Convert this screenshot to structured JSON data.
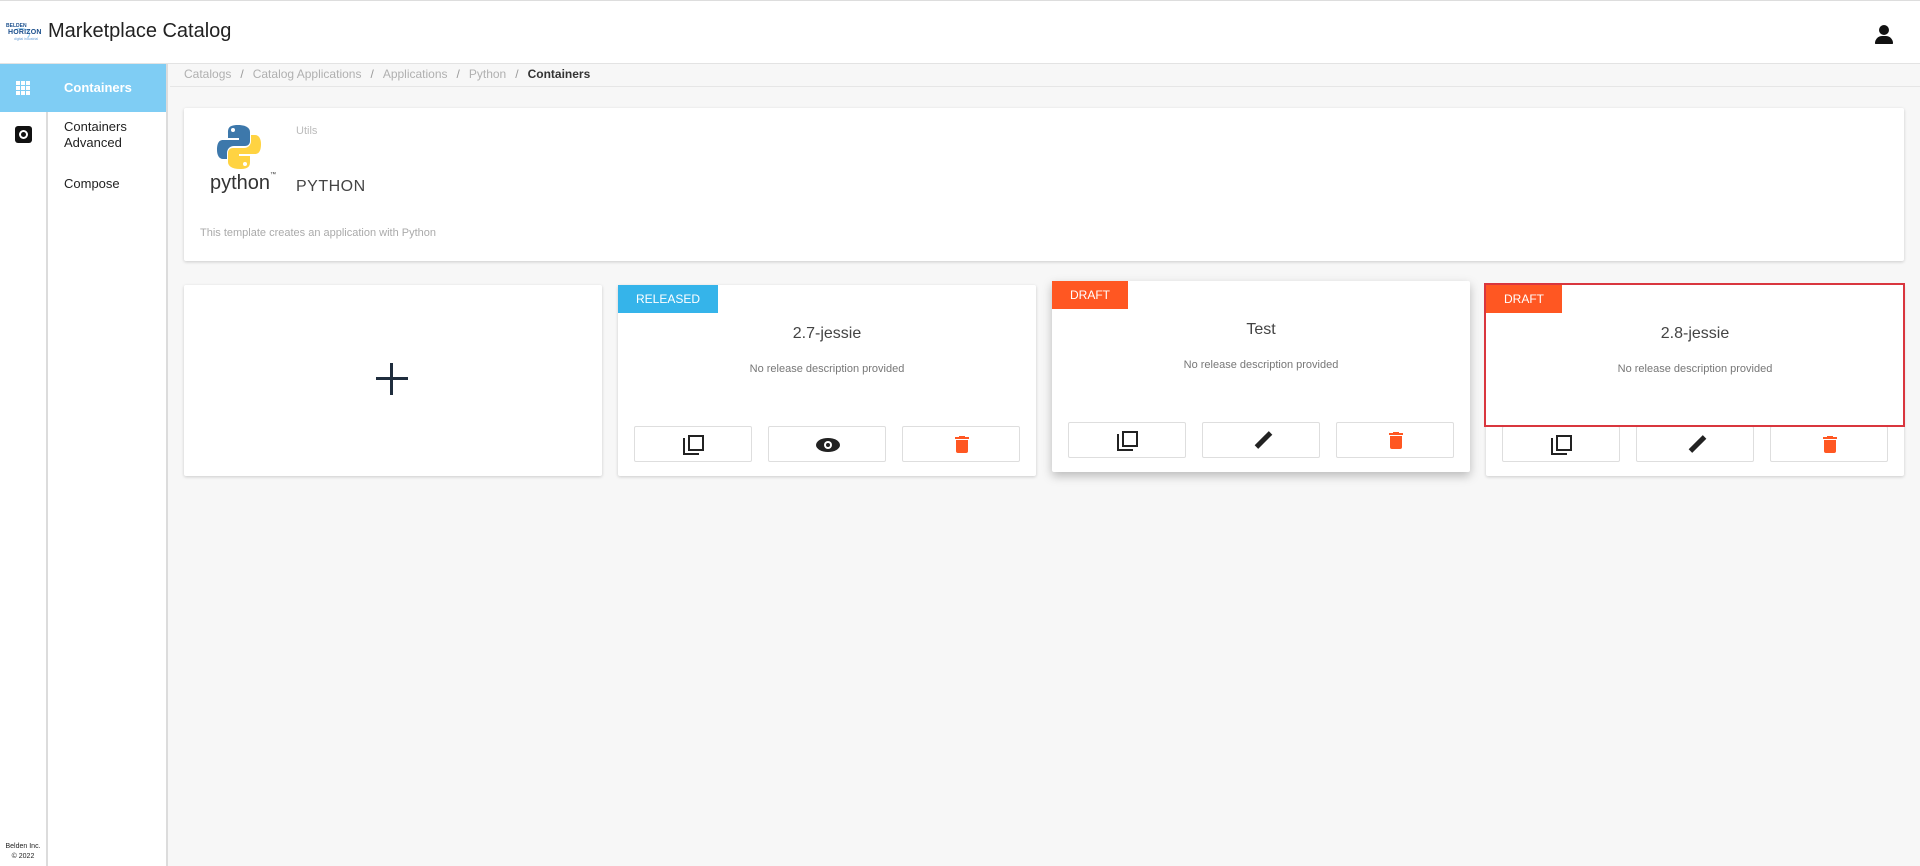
{
  "header": {
    "logo_line1": "BELDEN",
    "logo_line2": "HORIZON",
    "logo_line3": "digital industrial",
    "app_title": "Marketplace Catalog"
  },
  "rail": {
    "footer_line1": "Belden Inc.",
    "footer_line2": "© 2022"
  },
  "subnav": {
    "items": [
      {
        "label": "Containers",
        "active": true
      },
      {
        "label": "Containers Advanced",
        "active": false
      },
      {
        "label": "Compose",
        "active": false
      }
    ]
  },
  "breadcrumb": {
    "items": [
      "Catalogs",
      "Catalog Applications",
      "Applications",
      "Python"
    ],
    "current": "Containers",
    "separator": "/"
  },
  "template": {
    "logo_word": "python",
    "logo_tm": "™",
    "category": "Utils",
    "name": "PYTHON",
    "description": "This template creates an application with Python"
  },
  "cards": [
    {
      "status": "RELEASED",
      "title": "2.7-jessie",
      "description": "No release description provided",
      "actions": [
        "copy",
        "view",
        "delete"
      ]
    },
    {
      "status": "DRAFT",
      "title": "Test",
      "description": "No release description provided",
      "actions": [
        "copy",
        "edit",
        "delete"
      ]
    },
    {
      "status": "DRAFT",
      "title": "2.8-jessie",
      "description": "No release description provided",
      "actions": [
        "copy",
        "edit",
        "delete"
      ]
    }
  ],
  "colors": {
    "accent": "#7fcdf4",
    "released": "#35b4ea",
    "draft": "#ff5722",
    "delete": "#ff5722",
    "highlight": "#d9363e"
  }
}
